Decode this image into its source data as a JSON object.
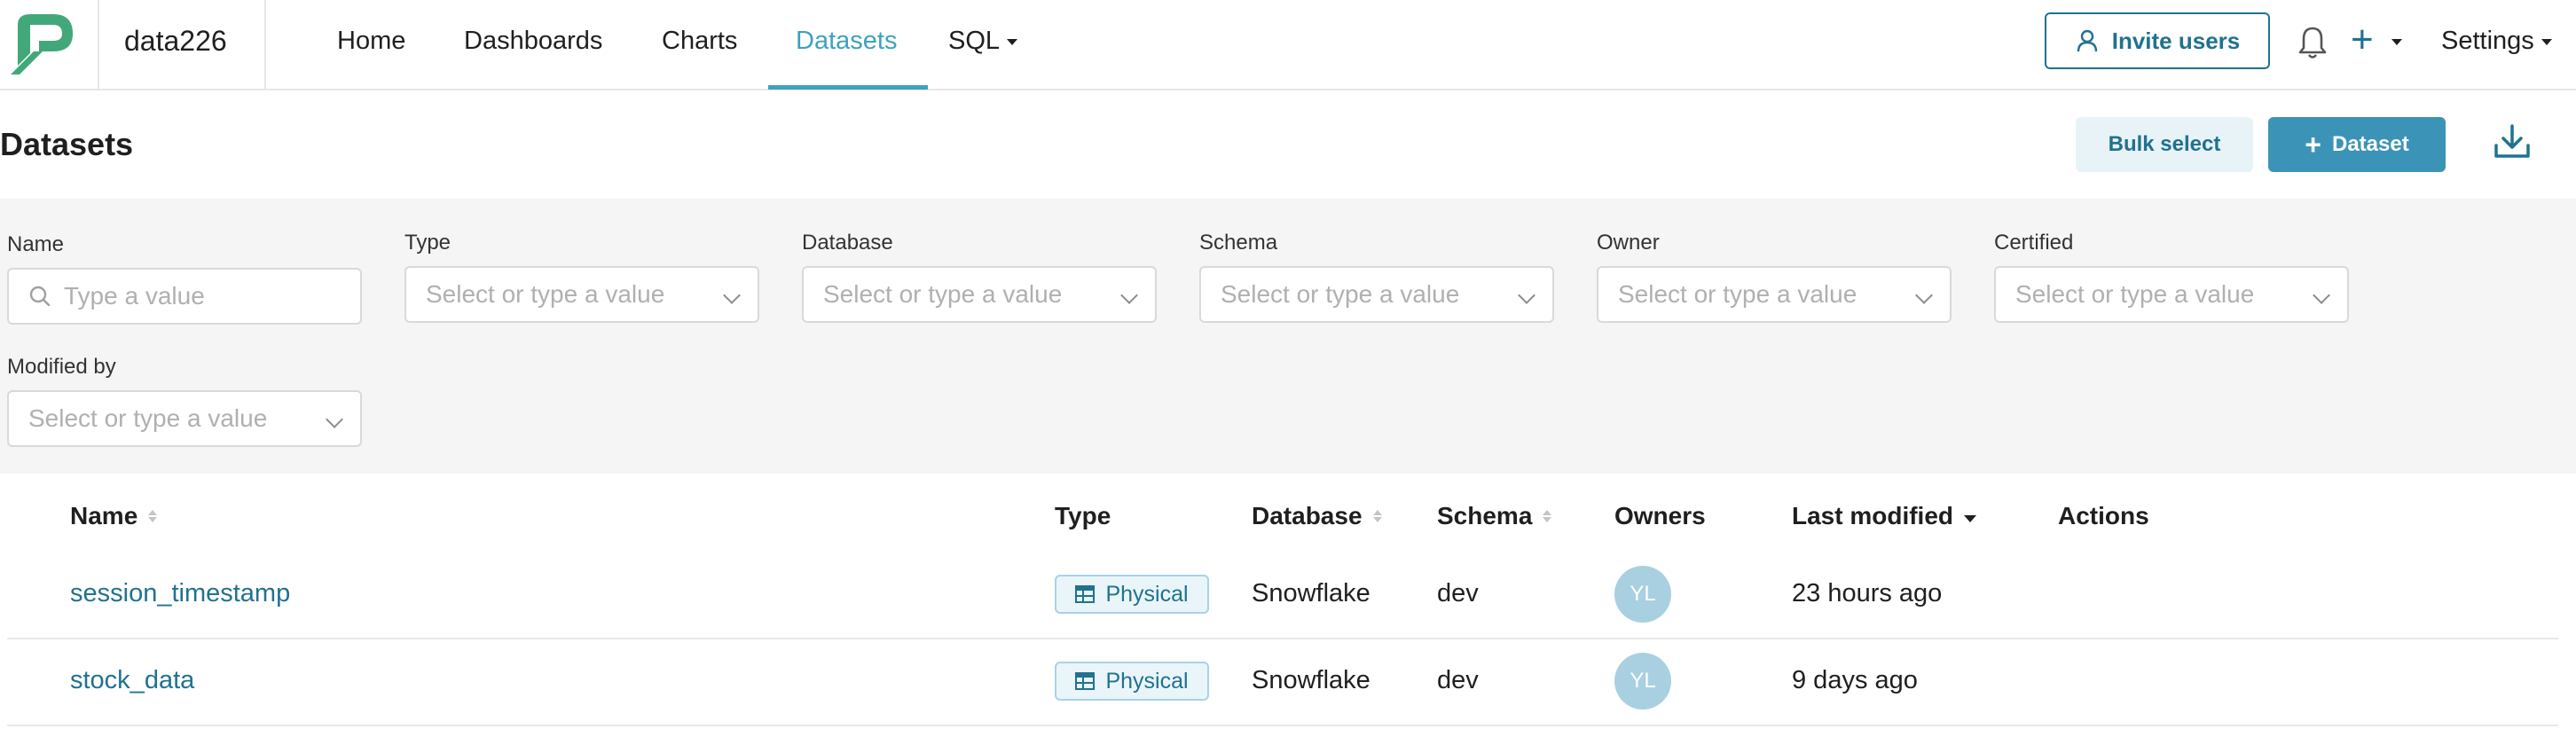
{
  "colors": {
    "accent": "#3fa1c2",
    "primary_dark": "#20728f",
    "filter_bg": "#f5f5f5"
  },
  "nav": {
    "brand": "data226",
    "items": [
      {
        "label": "Home"
      },
      {
        "label": "Dashboards"
      },
      {
        "label": "Charts"
      },
      {
        "label": "Datasets",
        "active": true
      },
      {
        "label": "SQL",
        "has_dropdown": true
      }
    ],
    "invite_label": "Invite users",
    "settings_label": "Settings",
    "icons": [
      "logo",
      "user-icon",
      "bell-icon",
      "plus-icon",
      "caret-down-icon"
    ]
  },
  "page": {
    "title": "Datasets",
    "bulk_select_label": "Bulk select",
    "dataset_label": "Dataset",
    "download_icon": "download-icon"
  },
  "filters": [
    {
      "label": "Name",
      "placeholder": "Type a value",
      "kind": "search"
    },
    {
      "label": "Type",
      "placeholder": "Select or type a value",
      "kind": "select"
    },
    {
      "label": "Database",
      "placeholder": "Select or type a value",
      "kind": "select"
    },
    {
      "label": "Schema",
      "placeholder": "Select or type a value",
      "kind": "select"
    },
    {
      "label": "Owner",
      "placeholder": "Select or type a value",
      "kind": "select"
    },
    {
      "label": "Certified",
      "placeholder": "Select or type a value",
      "kind": "select"
    },
    {
      "label": "Modified by",
      "placeholder": "Select or type a value",
      "kind": "select"
    }
  ],
  "table": {
    "columns": [
      "Name",
      "Type",
      "Database",
      "Schema",
      "Owners",
      "Last modified",
      "Actions"
    ],
    "rows": [
      {
        "name": "session_timestamp",
        "type": "Physical",
        "database": "Snowflake",
        "schema": "dev",
        "owner_initials": "YL",
        "last_modified": "23 hours ago"
      },
      {
        "name": "stock_data",
        "type": "Physical",
        "database": "Snowflake",
        "schema": "dev",
        "owner_initials": "YL",
        "last_modified": "9 days ago"
      }
    ]
  }
}
